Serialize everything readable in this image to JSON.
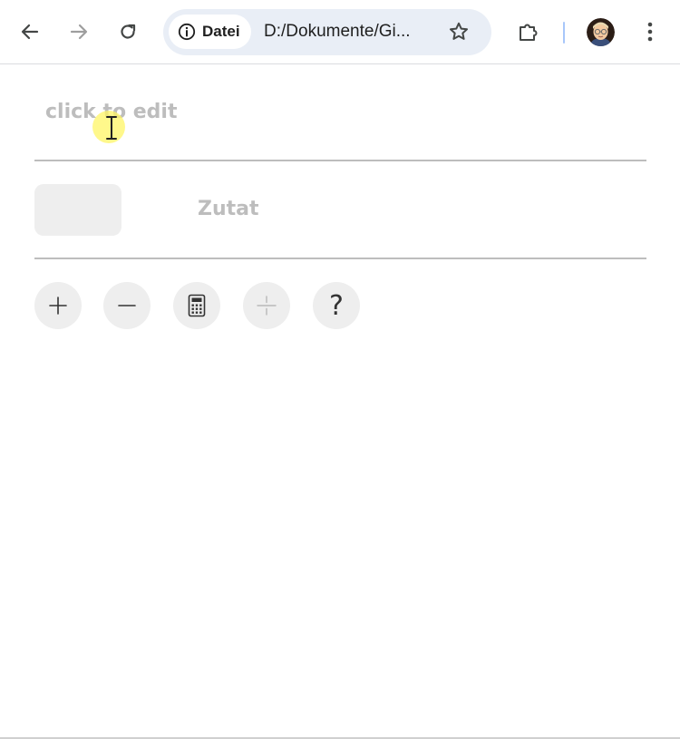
{
  "browser": {
    "security_chip_label": "Datei",
    "url": "D:/Dokumente/Gi...",
    "icons": {
      "back": "arrow-left-icon",
      "forward": "arrow-right-icon",
      "reload": "reload-icon",
      "info": "info-icon",
      "bookmark": "star-icon",
      "extensions": "puzzle-icon",
      "profile": "avatar",
      "menu": "kebab-menu-icon"
    },
    "colors": {
      "omnibox_bg": "#e9eef6",
      "separator": "#a8c7fa"
    }
  },
  "recipe": {
    "title_placeholder": "click to edit",
    "ingredient": {
      "amount_value": "",
      "name_placeholder": "Zutat"
    },
    "actions": [
      {
        "name": "add",
        "icon": "plus-icon"
      },
      {
        "name": "remove",
        "icon": "minus-icon"
      },
      {
        "name": "calculator",
        "icon": "calculator-icon"
      },
      {
        "name": "divide",
        "icon": "divide-icon",
        "disabled": true
      },
      {
        "name": "help",
        "icon": "question-mark-icon",
        "glyph": "?"
      }
    ]
  }
}
